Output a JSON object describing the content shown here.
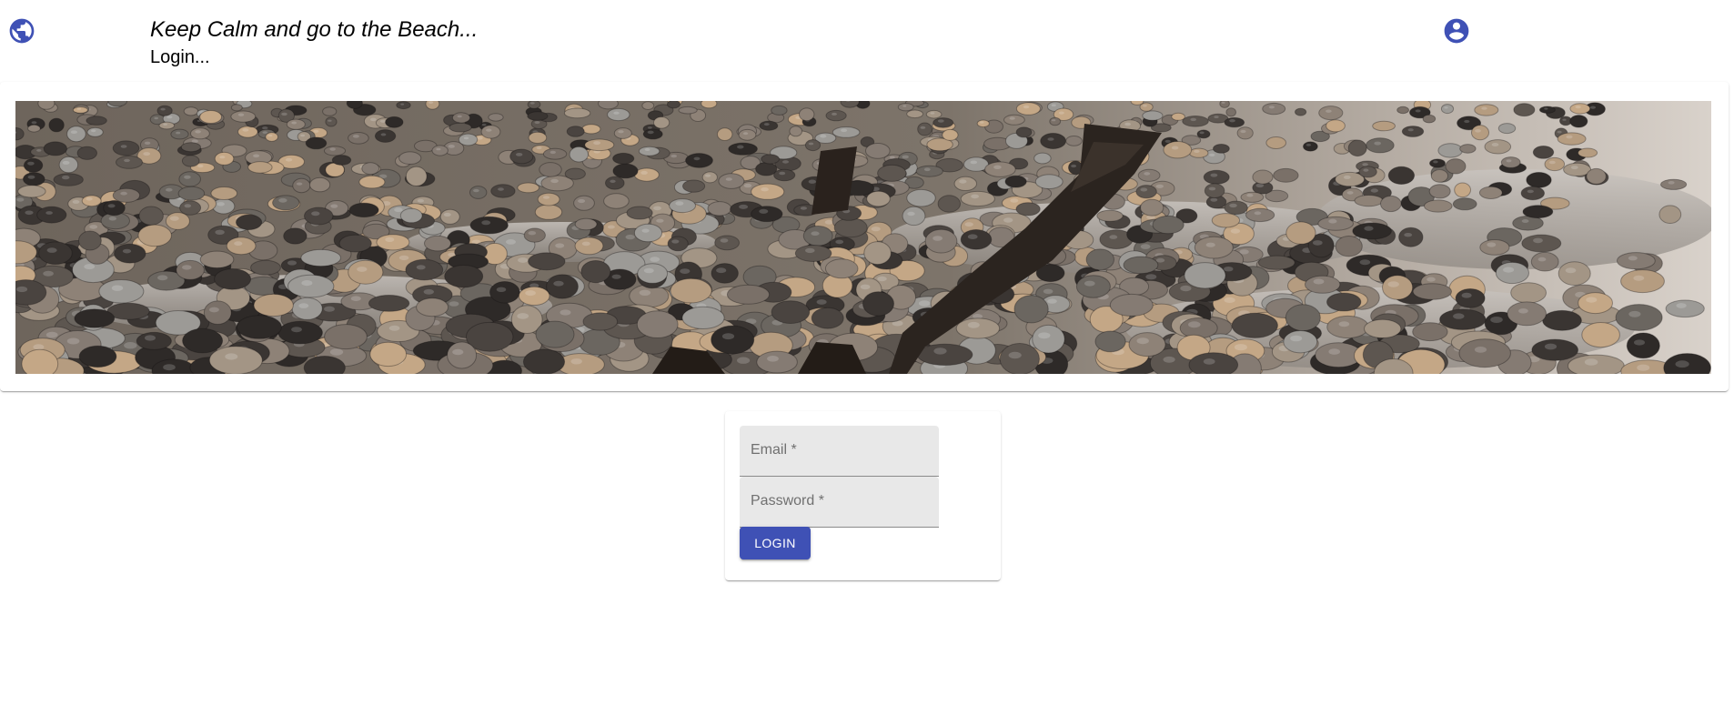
{
  "header": {
    "site_title": "Keep Calm and go to the Beach...",
    "page_subtitle": "Login...",
    "left_icon": "globe-icon",
    "right_icon": "account-circle-icon"
  },
  "banner": {
    "subject": "pebble beach with weathered wooden posts at low tide"
  },
  "login_form": {
    "email_label": "Email *",
    "password_label": "Password *",
    "login_button_label": "LOGIN"
  },
  "colors": {
    "primary": "#3f51b5",
    "field_background": "#e8e8e8"
  }
}
